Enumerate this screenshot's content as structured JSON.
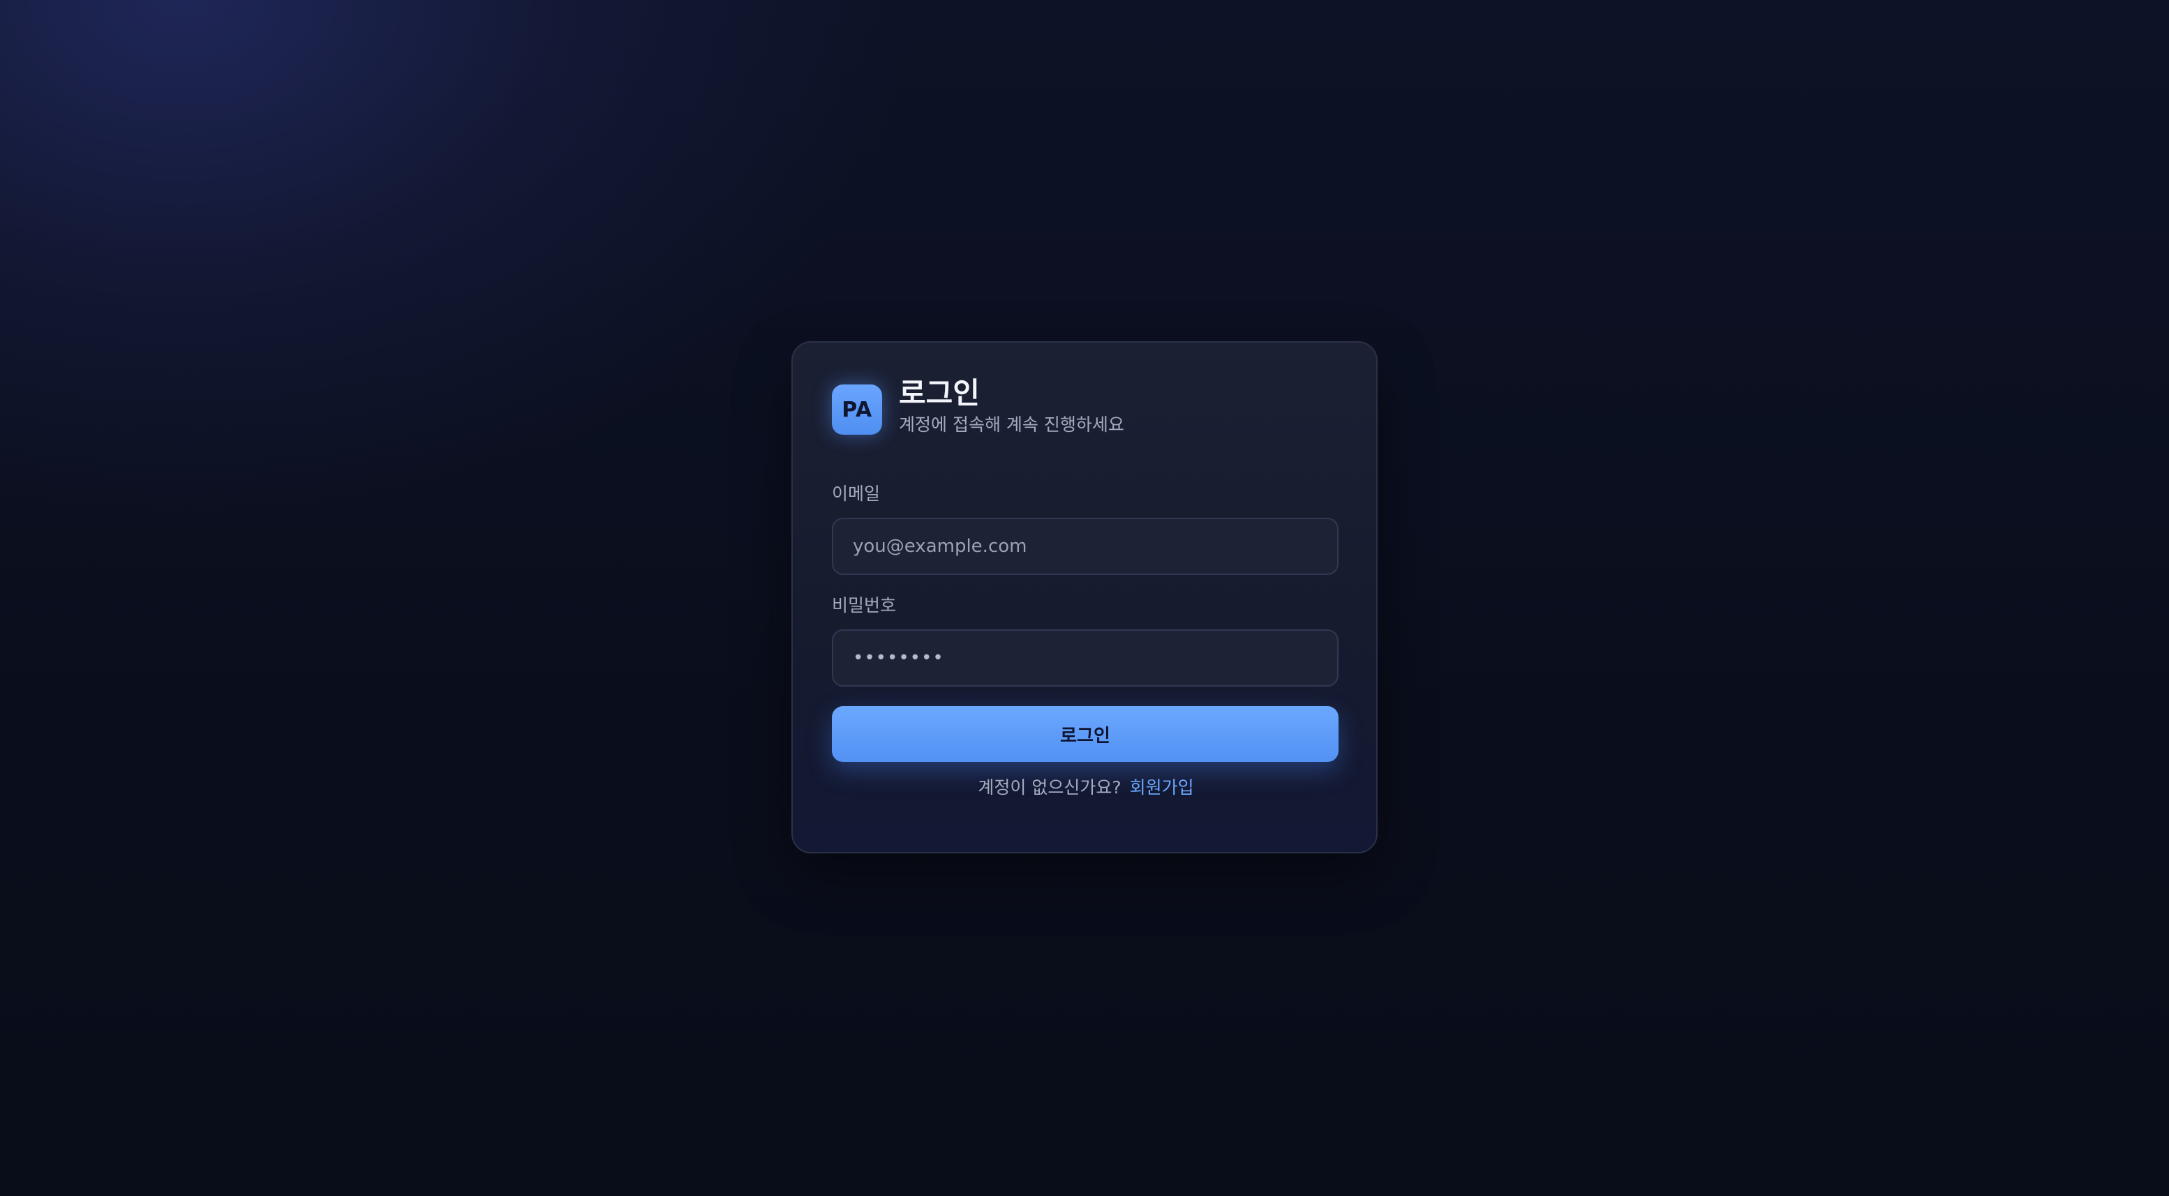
{
  "brand": {
    "logo_text": "PA"
  },
  "login_card": {
    "title": "로그인",
    "subtitle": "계정에 접속해 계속 진행하세요",
    "email": {
      "label": "이메일",
      "placeholder": "you@example.com",
      "value": ""
    },
    "password": {
      "label": "비밀번호",
      "value_masked": "••••••••"
    },
    "submit_label": "로그인",
    "footer": {
      "question": "계정이 없으신가요?",
      "signup_link": "회원가입"
    }
  },
  "colors": {
    "accent": "#5b9aff",
    "card_bg": "#181d30",
    "page_bg": "#0a0e1c"
  }
}
